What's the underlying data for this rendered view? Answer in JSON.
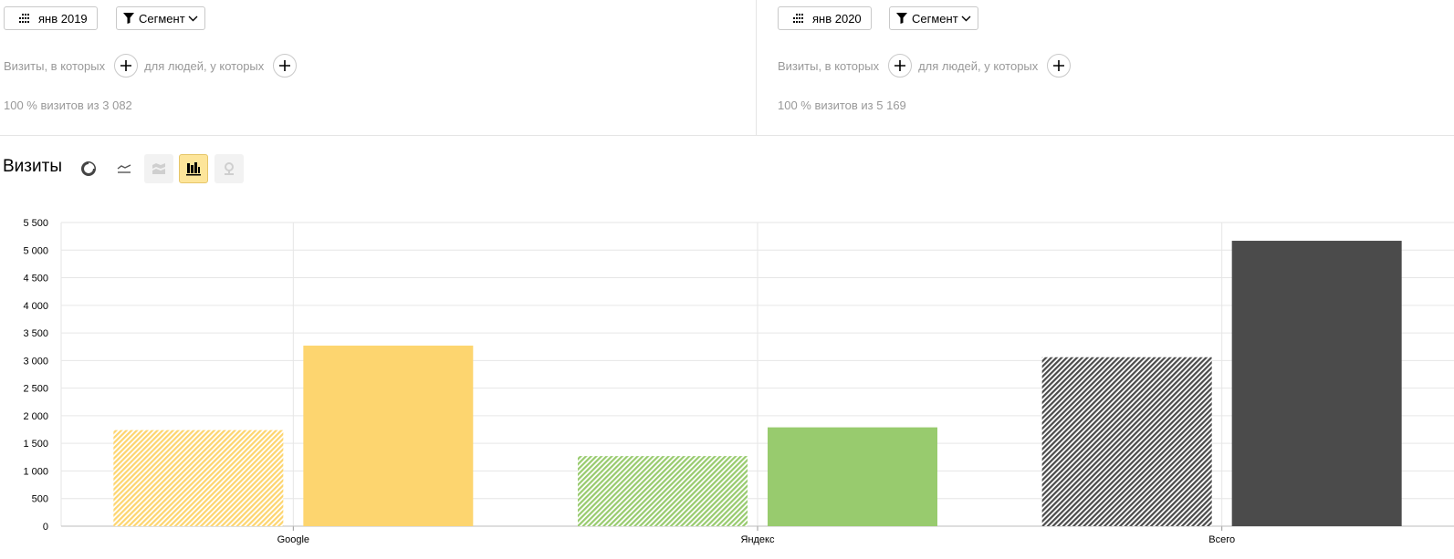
{
  "segments": [
    {
      "period_label": "янв 2019",
      "segment_label": "Сегмент",
      "visits_where": "Визиты, в которых",
      "people_where": "для людей, у которых",
      "share_text": "100 % визитов из 3 082"
    },
    {
      "period_label": "янв 2020",
      "segment_label": "Сегмент",
      "visits_where": "Визиты, в которых",
      "people_where": "для людей, у которых",
      "share_text": "100 % визитов из 5 169"
    }
  ],
  "metric_title": "Визиты",
  "view_buttons": [
    {
      "icon": "pie-chart-icon",
      "state": "normal"
    },
    {
      "icon": "line-chart-icon",
      "state": "normal"
    },
    {
      "icon": "area-chart-icon",
      "state": "disabled"
    },
    {
      "icon": "bar-chart-icon",
      "state": "active"
    },
    {
      "icon": "map-pin-icon",
      "state": "disabled"
    }
  ],
  "chart_data": {
    "type": "bar",
    "categories": [
      "Google",
      "Яндекс",
      "Всего"
    ],
    "series": [
      {
        "values": [
          1740,
          1270,
          3060
        ],
        "style": "hatched"
      },
      {
        "values": [
          3270,
          1790,
          5169
        ],
        "style": "solid"
      }
    ],
    "category_colors": [
      "#fdd56f",
      "#98cb6e",
      "#4b4b4b"
    ],
    "ylim": [
      0,
      5500
    ],
    "yticks": [
      0,
      500,
      1000,
      1500,
      2000,
      2500,
      3000,
      3500,
      4000,
      4500,
      5000,
      5500
    ],
    "grid": true
  }
}
